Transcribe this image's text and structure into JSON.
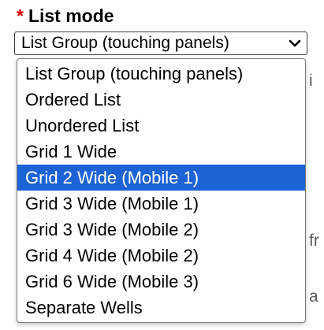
{
  "field": {
    "required_marker": "*",
    "label": "List mode"
  },
  "select": {
    "current_value": "List Group (touching panels)",
    "icon": "chevron-down-icon",
    "options": [
      {
        "label": "List Group (touching panels)",
        "selected": false
      },
      {
        "label": "Ordered List",
        "selected": false
      },
      {
        "label": "Unordered List",
        "selected": false
      },
      {
        "label": "Grid 1 Wide",
        "selected": false
      },
      {
        "label": "Grid 2 Wide (Mobile 1)",
        "selected": true
      },
      {
        "label": "Grid 3 Wide (Mobile 1)",
        "selected": false
      },
      {
        "label": "Grid 3 Wide (Mobile 2)",
        "selected": false
      },
      {
        "label": "Grid 4 Wide (Mobile 2)",
        "selected": false
      },
      {
        "label": "Grid 6 Wide (Mobile 3)",
        "selected": false
      },
      {
        "label": "Separate Wells",
        "selected": false
      }
    ]
  },
  "background_fragments": {
    "right_1": "i",
    "right_2": "fr",
    "right_3": "a"
  },
  "colors": {
    "required": "#d40000",
    "highlight": "#1e63d6",
    "highlight_text": "#ffffff"
  }
}
